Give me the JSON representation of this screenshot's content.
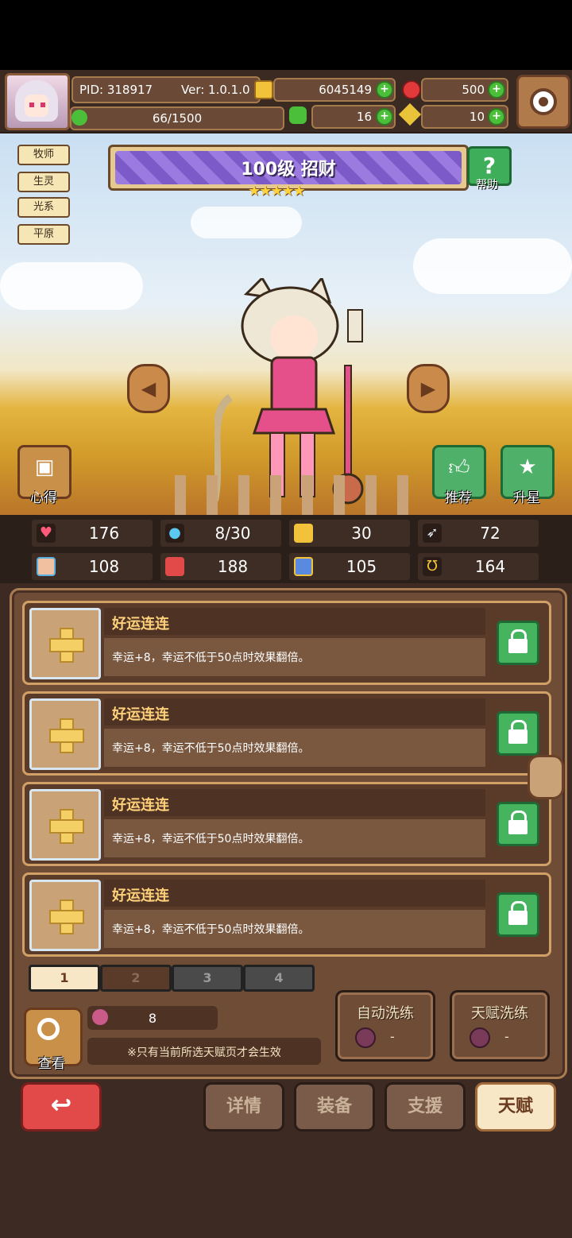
{
  "hud": {
    "pid": "PID: 318917",
    "version": "Ver: 1.0.1.0",
    "gold": "6045149",
    "gems": "500",
    "exp": "66/1500",
    "clover": "16",
    "key": "10"
  },
  "tags": [
    "牧师",
    "生灵",
    "光系",
    "平原"
  ],
  "hero": {
    "title": "100级  招财",
    "stars": "★★★★★",
    "help_label": "帮助"
  },
  "scene_buttons": {
    "insight": "心得",
    "recommend": "推荐",
    "star_up": "升星"
  },
  "stats": [
    {
      "icon": "heart-icon",
      "value": "176"
    },
    {
      "icon": "drop-icon",
      "value": "8/30"
    },
    {
      "icon": "shield-icon",
      "value": "30"
    },
    {
      "icon": "wing-icon",
      "value": "72"
    },
    {
      "icon": "fist-icon",
      "value": "108"
    },
    {
      "icon": "book-icon",
      "value": "188"
    },
    {
      "icon": "scroll-icon",
      "value": "105"
    },
    {
      "icon": "horseshoe-icon",
      "value": "164"
    }
  ],
  "talents": [
    {
      "name": "好运连连",
      "desc": "幸运+8，幸运不低于50点时效果翻倍。"
    },
    {
      "name": "好运连连",
      "desc": "幸运+8，幸运不低于50点时效果翻倍。"
    },
    {
      "name": "好运连连",
      "desc": "幸运+8，幸运不低于50点时效果翻倍。"
    },
    {
      "name": "好运连连",
      "desc": "幸运+8，幸运不低于50点时效果翻倍。"
    }
  ],
  "pages": [
    "1",
    "2",
    "3",
    "4"
  ],
  "bottom": {
    "view_label": "查看",
    "potion_count": "8",
    "note": "※只有当前所选天赋页才会生效",
    "auto_wash": "自动洗练",
    "auto_wash_cost": "-",
    "talent_wash": "天赋洗练",
    "talent_wash_cost": "-"
  },
  "nav": {
    "back": "↩",
    "details": "详情",
    "equip": "装备",
    "support": "支援",
    "talent": "天赋"
  },
  "colors": {
    "accent_gold": "#ffd07a",
    "active_tab": "#f8e7c6",
    "lock_green": "#46b45e",
    "back_red": "#e24a4a"
  }
}
